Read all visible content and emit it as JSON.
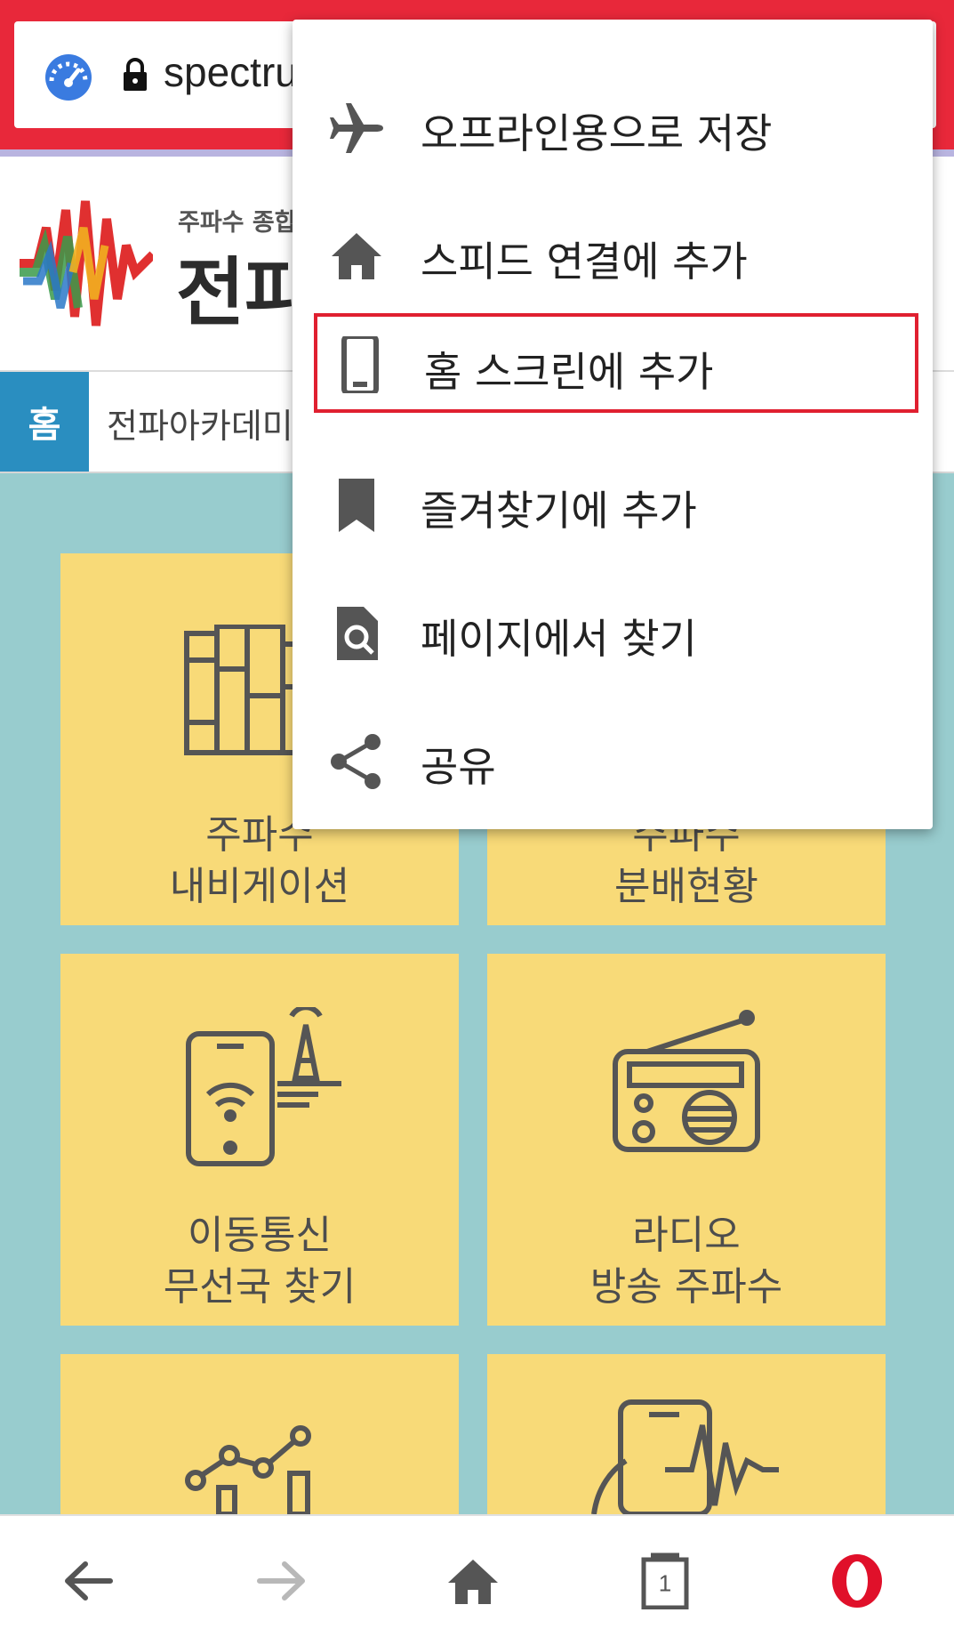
{
  "browser": {
    "url_partial": "spectru",
    "accent_color": "#e8283a"
  },
  "site": {
    "logo_subtitle": "주파수 종합",
    "logo_title": "전파",
    "breadcrumb_home": "홈",
    "breadcrumb_text": "전파아카데미"
  },
  "tiles": [
    {
      "label": "주파수\n내비게이션",
      "icon": "books-icon"
    },
    {
      "label": "주파수\n분배현황",
      "icon": "partial-hidden"
    },
    {
      "label": "이동통신\n무선국 찾기",
      "icon": "phone-tower-icon"
    },
    {
      "label": "라디오\n방송 주파수",
      "icon": "radio-icon"
    },
    {
      "label": "",
      "icon": "chart-icon"
    },
    {
      "label": "",
      "icon": "hand-phone-icon"
    }
  ],
  "menu": {
    "items": [
      {
        "label": "오프라인용으로 저장",
        "icon": "airplane-icon"
      },
      {
        "label": "스피드 연결에 추가",
        "icon": "home-icon"
      },
      {
        "label": "홈 스크린에 추가",
        "icon": "smartphone-icon",
        "highlighted": true
      },
      {
        "label": "즐겨찾기에 추가",
        "icon": "bookmark-icon"
      },
      {
        "label": "페이지에서 찾기",
        "icon": "find-in-page-icon"
      },
      {
        "label": "공유",
        "icon": "share-icon"
      }
    ]
  },
  "bottom_nav": {
    "tab_count": "1"
  }
}
